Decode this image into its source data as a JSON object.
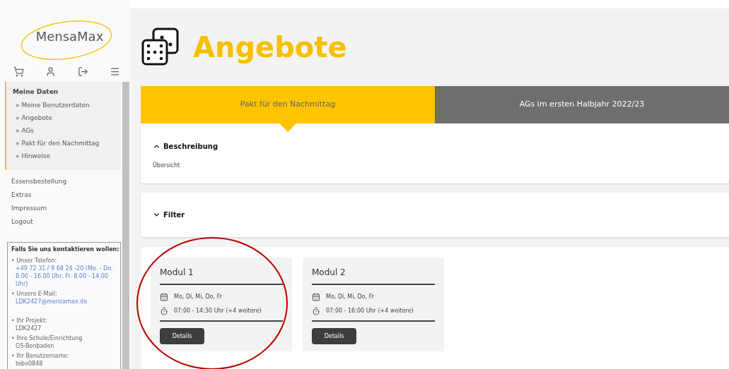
{
  "logo": {
    "text": "MensaMax"
  },
  "sidebar": {
    "menu_group": {
      "title": "Meine Daten",
      "items": [
        {
          "label": "Meine Benutzerdaten",
          "marker": "»"
        },
        {
          "label": "Angebote",
          "marker": "»"
        },
        {
          "label": "AGs",
          "marker": "»"
        },
        {
          "label": "Pakt für den Nachmittag",
          "marker": "»"
        },
        {
          "label": "Hinweise",
          "marker": "»"
        }
      ]
    },
    "links": [
      "Essensbestellung",
      "Extras",
      "Impressum",
      "Logout"
    ],
    "contact": {
      "title": "Falls Sie uns kontaktieren wollen:",
      "entries": [
        {
          "bullet": "•",
          "label": "Unser Telefon:",
          "value": "+49 72 31 / 9 68 24 -20 (Mo. - Do. 8.00 - 16.00 Uhr, Fr. 8.00 - 14.00 Uhr)",
          "kind": "link"
        },
        {
          "bullet": "•",
          "label": "Unsere E-Mail:",
          "value": "LDK2427@mensamax.de",
          "kind": "link"
        },
        {
          "bullet": "•",
          "label": "Ihr Projekt:",
          "value": "LDK2427",
          "kind": "text"
        },
        {
          "bullet": "•",
          "label": "Ihre Schule/Einrichtung",
          "value": "GS-Bonbaden",
          "kind": "text"
        },
        {
          "bullet": "•",
          "label": "Ihr Benutzername:",
          "value": "tebo0848",
          "kind": "text"
        }
      ]
    }
  },
  "page": {
    "title": "Angebote"
  },
  "tabs": [
    {
      "label": "Pakt für den Nachmittag",
      "selected": true
    },
    {
      "label": "AGs im ersten Halbjahr 2022/23",
      "selected": false
    }
  ],
  "description": {
    "title": "Beschreibung",
    "expanded": true,
    "text": "Übersicht"
  },
  "filter": {
    "title": "Filter",
    "expanded": false
  },
  "modules": [
    {
      "title": "Modul 1",
      "days": "Mo, Di, Mi, Do, Fr",
      "time": "07:00 - 14:30 Uhr (+4 weitere)",
      "button": "Details",
      "highlighted": true
    },
    {
      "title": "Modul 2",
      "days": "Mo, Di, Mi, Do, Fr",
      "time": "07:00 - 16:00 Uhr (+4 weitere)",
      "button": "Details",
      "highlighted": false
    }
  ]
}
